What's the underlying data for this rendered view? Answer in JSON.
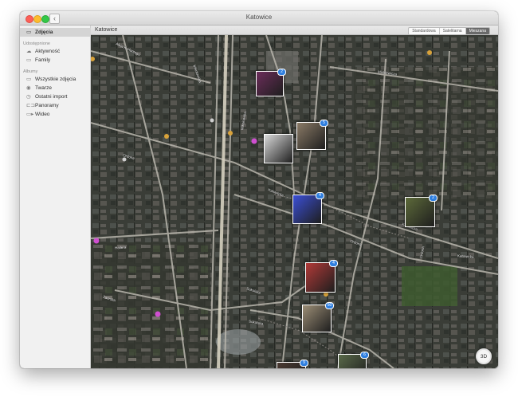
{
  "window": {
    "title": "Katowice",
    "back_label": "‹"
  },
  "sidebar": {
    "top_item": "Zdjęcia",
    "shared_header": "Udostępnione",
    "shared_items": [
      "Aktywność",
      "Family"
    ],
    "albums_header": "Albumy",
    "album_items": [
      "Wszystkie zdjęcia",
      "Twarze",
      "Ostatni import",
      "Panoramy",
      "Wideo"
    ]
  },
  "map": {
    "title": "Katowice",
    "view_modes": [
      "Standardowa",
      "Satelitarna",
      "Mieszana"
    ],
    "active_mode": "Mieszana",
    "compass_label": "3D",
    "zoom_out": "−",
    "zoom_in": "+",
    "pins": [
      {
        "badge": "2",
        "color": "#6b2d5a"
      },
      {
        "badge": "5",
        "color": "#8a7a66"
      },
      {
        "badge": "",
        "color": "#d9d9d9"
      },
      {
        "badge": "4",
        "color": "#3b4fd6"
      },
      {
        "badge": "2",
        "color": "#5d6a3a"
      },
      {
        "badge": "4",
        "color": "#b23a38"
      },
      {
        "badge": "50",
        "color": "#9c8e76"
      },
      {
        "badge": "9",
        "color": "#4a3a32"
      },
      {
        "badge": "6",
        "color": "#5a6a4a"
      }
    ],
    "street_labels": [
      "Aleja Korfantego",
      "Mikołowska",
      "Mikołowska",
      "Ordona",
      "Ordona",
      "Katowicka",
      "Katowicka",
      "Hallera",
      "Zabrska",
      "Mickiewicza",
      "Sokolska",
      "Sokolska",
      "Ordona",
      "Katowicka"
    ]
  }
}
